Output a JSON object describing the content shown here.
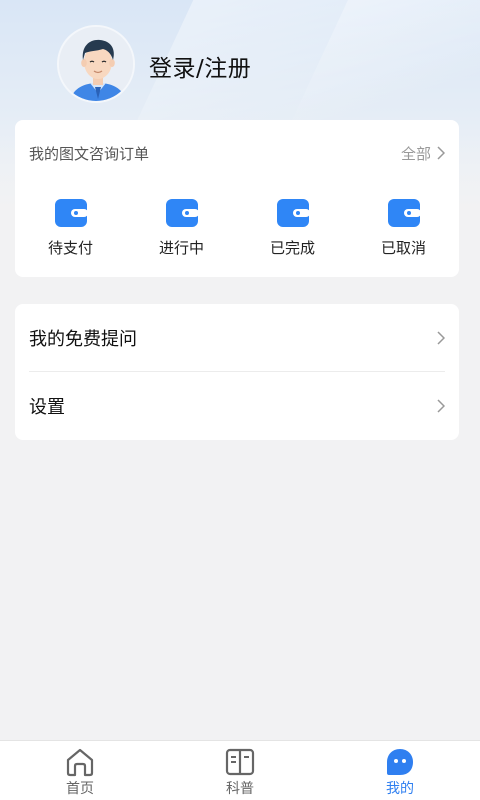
{
  "profile": {
    "login_label": "登录/注册"
  },
  "orders": {
    "title": "我的图文咨询订单",
    "all_label": "全部",
    "items": [
      {
        "label": "待支付",
        "icon": "wallet-icon"
      },
      {
        "label": "进行中",
        "icon": "wallet-icon"
      },
      {
        "label": "已完成",
        "icon": "wallet-icon"
      },
      {
        "label": "已取消",
        "icon": "wallet-icon"
      }
    ]
  },
  "menu": {
    "items": [
      {
        "label": "我的免费提问"
      },
      {
        "label": "设置"
      }
    ]
  },
  "tabbar": {
    "tabs": [
      {
        "label": "首页",
        "icon": "home-icon"
      },
      {
        "label": "科普",
        "icon": "book-icon"
      },
      {
        "label": "我的",
        "icon": "profile-icon"
      }
    ],
    "active_index": 2
  },
  "colors": {
    "accent": "#2f7ff0",
    "wallet_icon": "#2f86f6"
  }
}
